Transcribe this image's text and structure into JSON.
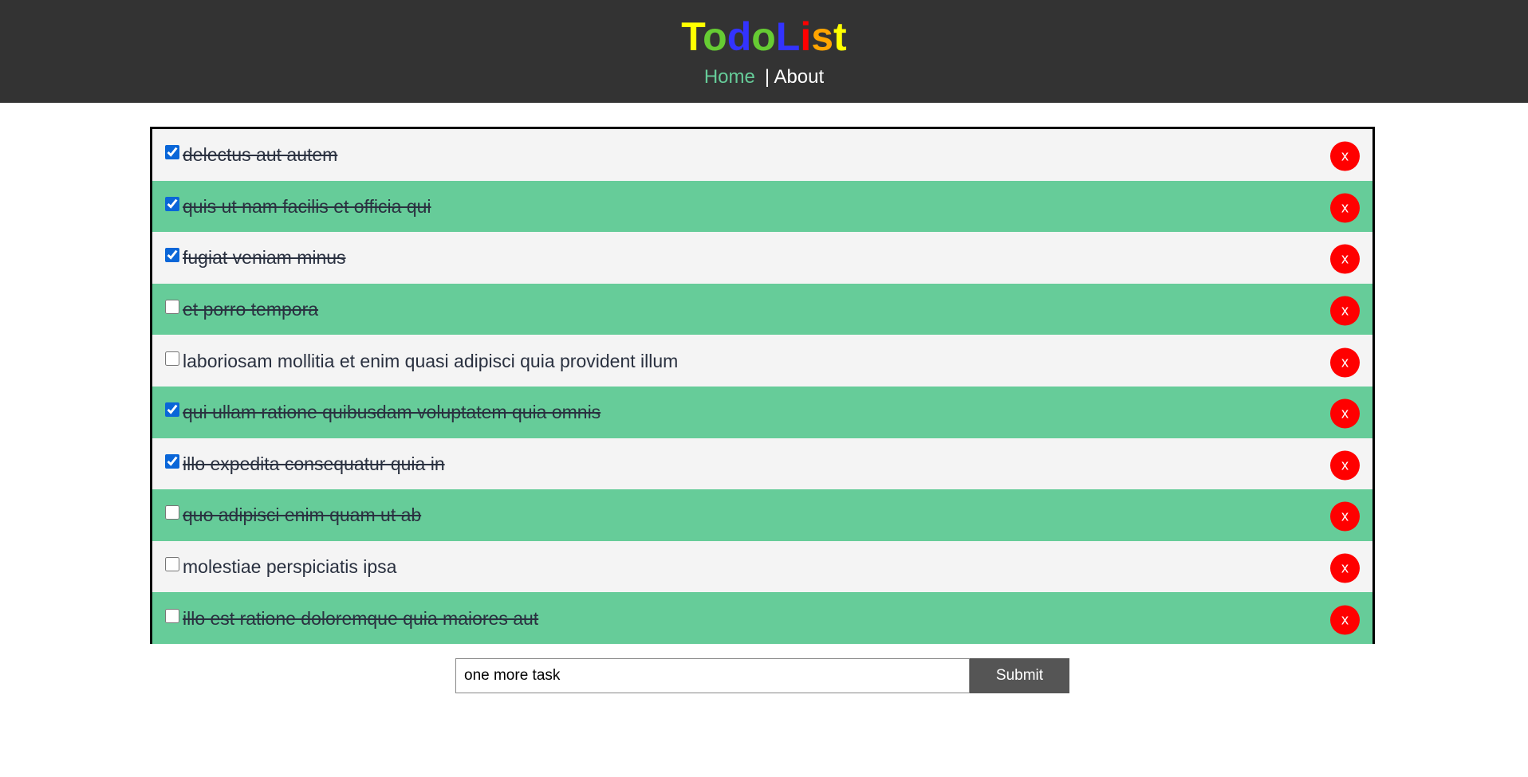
{
  "header": {
    "logo_letters": [
      {
        "char": "T",
        "color": "#ffff00"
      },
      {
        "char": "o",
        "color": "#66cc33"
      },
      {
        "char": "d",
        "color": "#3333ff"
      },
      {
        "char": "o",
        "color": "#66cc33"
      },
      {
        "char": "L",
        "color": "#3333ff"
      },
      {
        "char": "i",
        "color": "#ff0000"
      },
      {
        "char": "s",
        "color": "#ffa500"
      },
      {
        "char": "t",
        "color": "#ffff00"
      }
    ],
    "nav": {
      "home_label": "Home",
      "separator": "|",
      "about_label": "About"
    }
  },
  "todos": [
    {
      "title": "delectus aut autem",
      "checked": true,
      "completed": true,
      "delete_label": "x"
    },
    {
      "title": "quis ut nam facilis et officia qui",
      "checked": true,
      "completed": true,
      "delete_label": "x"
    },
    {
      "title": "fugiat veniam minus",
      "checked": true,
      "completed": true,
      "delete_label": "x"
    },
    {
      "title": "et porro tempora",
      "checked": false,
      "completed": true,
      "delete_label": "x"
    },
    {
      "title": "laboriosam mollitia et enim quasi adipisci quia provident illum",
      "checked": false,
      "completed": false,
      "delete_label": "x"
    },
    {
      "title": "qui ullam ratione quibusdam voluptatem quia omnis",
      "checked": true,
      "completed": true,
      "delete_label": "x"
    },
    {
      "title": "illo expedita consequatur quia in",
      "checked": true,
      "completed": true,
      "delete_label": "x"
    },
    {
      "title": "quo adipisci enim quam ut ab",
      "checked": false,
      "completed": true,
      "delete_label": "x"
    },
    {
      "title": "molestiae perspiciatis ipsa",
      "checked": false,
      "completed": false,
      "delete_label": "x"
    },
    {
      "title": "illo est ratione doloremque quia maiores aut",
      "checked": false,
      "completed": true,
      "delete_label": "x"
    }
  ],
  "add_form": {
    "input_value": "one more task",
    "submit_label": "Submit"
  },
  "colors": {
    "header_bg": "#333333",
    "row_odd": "#f4f4f4",
    "row_even": "#66cc99",
    "delete_button": "#ff0000",
    "submit_button": "#555555",
    "nav_active": "#66cc99"
  }
}
